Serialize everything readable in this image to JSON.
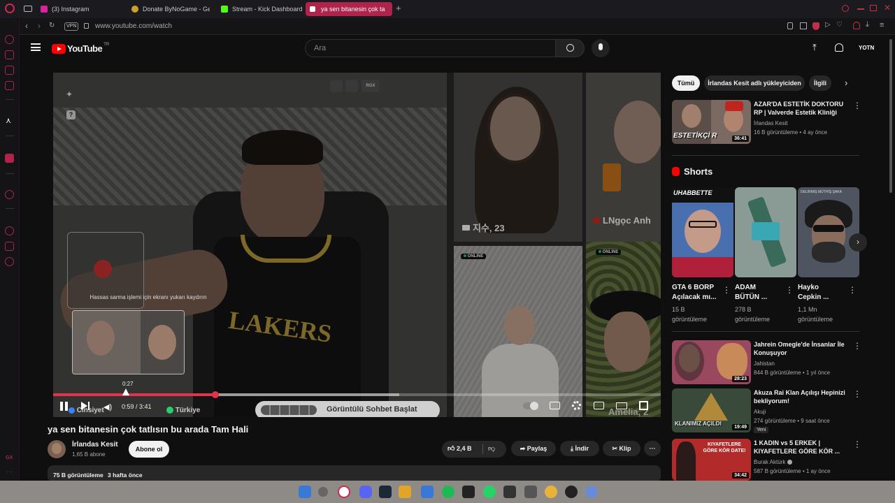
{
  "browser": {
    "tabs": [
      {
        "label": "(3) Instagram",
        "color": "#d6249f"
      },
      {
        "label": "Donate ByNoGame - Gelen",
        "color": "#c9a227"
      },
      {
        "label": "Stream - Kick Dashboard",
        "color": "#53fc18"
      },
      {
        "label": "ya sen bitanesin çok ta",
        "color": "#ffffff"
      }
    ],
    "vpn": "VPN",
    "url": "www.youtube.com/watch"
  },
  "yt": {
    "logo": "YouTube",
    "logo_tr": "TR",
    "search_placeholder": "Ara",
    "avatar": "YOTN"
  },
  "video": {
    "title": "ya sen bitanesin çok tatlısın bu arada Tam Hali",
    "time_current": "0:59",
    "time_total": "3:41",
    "time_display": "0:59 / 3:41",
    "hover_time": "0:27",
    "progress_fraction": 0.267,
    "buffered_fraction": 0.57,
    "hover_fraction": 0.12,
    "scrub_hint": "Hassas sarma işlemi için ekranı yukarı kaydırın",
    "overlay_left_label": "Cinsiyet",
    "overlay_country": "Türkiye",
    "overlay_button": "Görüntülü Sohbet Başlat",
    "tile1_name": "지수, 23",
    "tile2_name": "LNgọc Anh",
    "tile3_badge": "ONLINE",
    "tile4_badge": "ONLINE",
    "tile4_name": "Amelia, 2",
    "top_label": "RGX"
  },
  "channel": {
    "name": "İrlandas Kesit",
    "subs": "1,65 B abone",
    "subscribe": "Abone ol",
    "likes": "2,4 B",
    "share": "Paylaş",
    "download": "İndir",
    "clip": "Klip",
    "views": "75 B görüntüleme",
    "age": "3 hafta önce"
  },
  "chips": [
    "Tümü",
    "İrlandas Kesit adlı yükleyiciden",
    "İlgili"
  ],
  "related_top": {
    "title_1": "AZAR'DA ESTETİK DOKTORU",
    "title_2": "RP | Valverde Estetik Kliniği",
    "channel": "İrlandas Kesit",
    "meta": "16 B görüntüleme • 4 ay önce",
    "duration": "36:41",
    "thumb_text": "ESTETİKÇİ R"
  },
  "shorts": {
    "heading": "Shorts",
    "items": [
      {
        "t1": "GTA 6 BORP",
        "t2": "Açılacak mı...",
        "v1": "15 B",
        "v2": "görüntüleme",
        "banner": "UHABBETTE"
      },
      {
        "t1": "ADAM",
        "t2": "BÜTÜN ...",
        "v1": "278 B",
        "v2": "görüntüleme",
        "banner": ""
      },
      {
        "t1": "Hayko",
        "t2": "Cepkin ...",
        "v1": "1,1 Mn",
        "v2": "görüntüleme",
        "banner": "DELIRMIŞ MÜTHİŞ ŞAKA"
      }
    ]
  },
  "related": [
    {
      "t1": "Jahrein Omegle'de İnsanlar İle",
      "t2": "Konuşuyor",
      "channel": "Jahistan",
      "meta": "844 B görüntüleme • 1 yıl önce",
      "duration": "28:23",
      "badge": ""
    },
    {
      "t1": "Akuza Rai Klan Açılışı Hepinizi",
      "t2": "bekliyorum!",
      "channel": "Akuji",
      "meta": "274 görüntüleme • 9 saat önce",
      "duration": "19:49",
      "badge": "Yeni",
      "thumb_text": "KLANIMIZ AÇILDI"
    },
    {
      "t1": "1 KADIN vs 5 ERKEK |",
      "t2": "KIYAFETLERE GÖRE KÖR ...",
      "channel": "Burak Aktürk",
      "meta": "587 B görüntüleme • 1 ay önce",
      "duration": "34:42",
      "badge": "",
      "thumb_text": "KIYAFETLERE GÖRE KÖR DATE!"
    }
  ],
  "colors": {
    "accent": "#b0234a",
    "progress": "#e0344a",
    "yt_red": "#ff0000"
  }
}
